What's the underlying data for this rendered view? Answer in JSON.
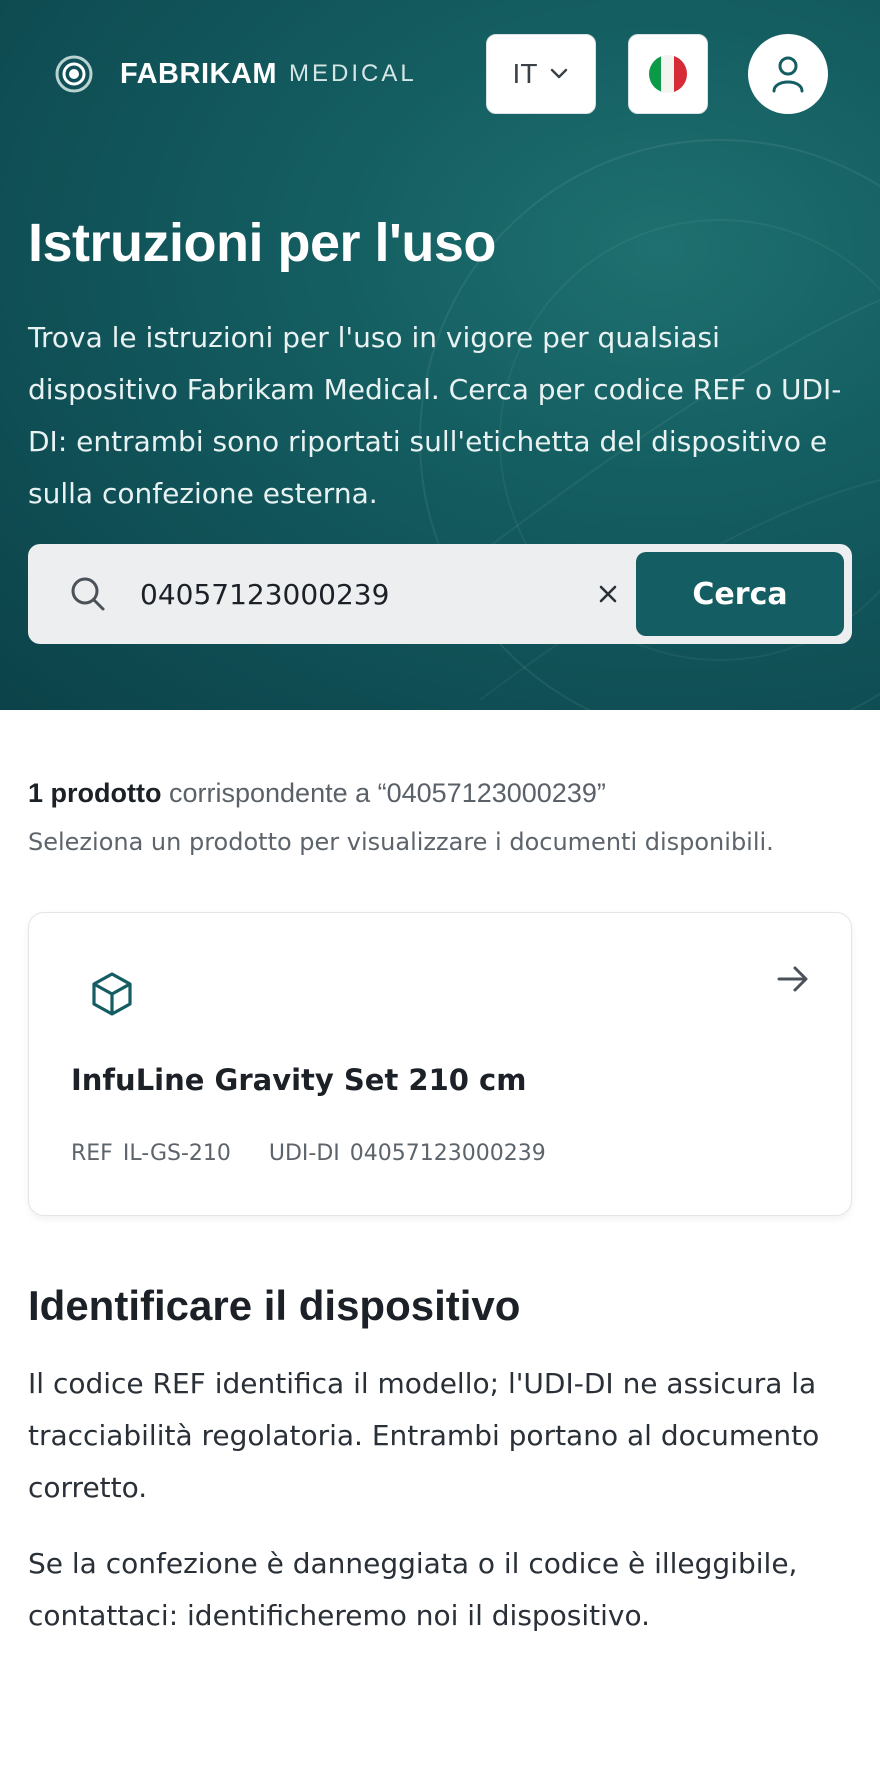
{
  "header": {
    "brand_name": "FABRIKAM",
    "brand_sub": "MEDICAL",
    "language_code": "IT",
    "flag_icon": "italy-flag-icon",
    "user_icon": "user-icon"
  },
  "hero": {
    "title": "Istruzioni per l'uso",
    "description": "Trova le istruzioni per l'uso in vigore per qualsiasi dispositivo Fabrikam Medical. Cerca per codice REF o UDI-DI: entrambi sono riportati sull'etichetta del dispositivo e sulla confezione esterna."
  },
  "search": {
    "value": "04057123000239",
    "button_label": "Cerca",
    "search_icon": "search-icon",
    "clear_icon": "close-icon"
  },
  "results": {
    "count_label": "1 prodotto",
    "match_text": "corrispondente a “04057123000239”",
    "hint": "Seleziona un prodotto per visualizzare i documenti disponibili."
  },
  "product": {
    "icon": "cube-icon",
    "name": "InfuLine Gravity Set 210 cm",
    "ref_label": "REF",
    "ref_value": "IL-GS-210",
    "udi_label": "UDI-DI",
    "udi_value": "04057123000239"
  },
  "info": {
    "title": "Identificare il dispositivo",
    "para1": "Il codice REF identifica il modello; l'UDI-DI ne assicura la tracciabilità regolatoria. Entrambi portano al documento corretto.",
    "para2": "Se la confezione è danneggiata o il codice è illeggibile, contattaci: identificheremo noi il dispositivo."
  },
  "colors": {
    "hero_bg": "#145e61",
    "accent": "#145d62",
    "text_dark": "#1c2127",
    "text_muted": "#5d646b"
  }
}
